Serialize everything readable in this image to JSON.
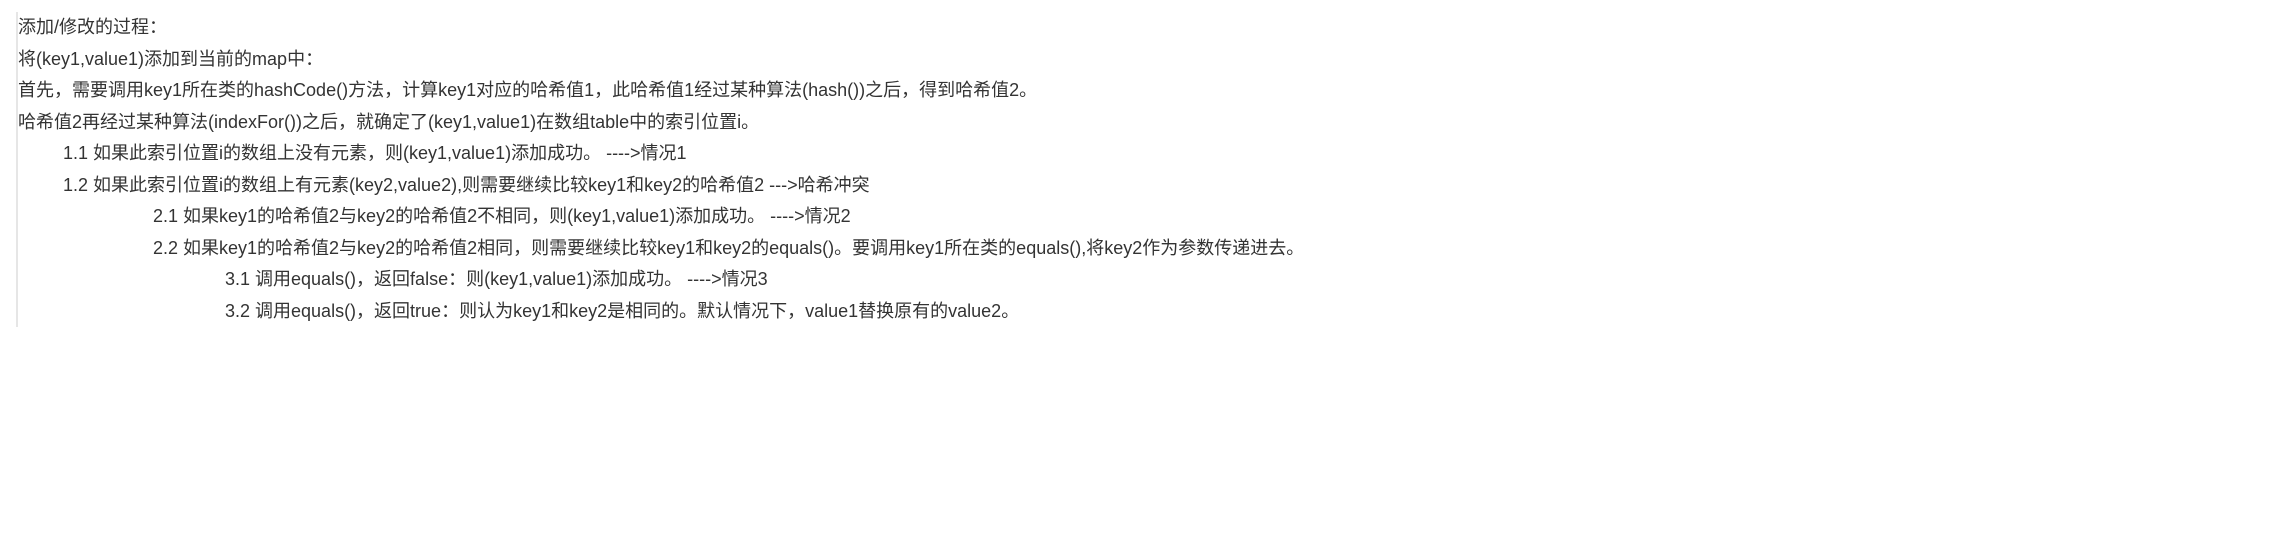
{
  "lines": {
    "l1": "添加/修改的过程：",
    "l2": "将(key1,value1)添加到当前的map中：",
    "l3": "首先，需要调用key1所在类的hashCode()方法，计算key1对应的哈希值1，此哈希值1经过某种算法(hash())之后，得到哈希值2。",
    "l4": "哈希值2再经过某种算法(indexFor())之后，就确定了(key1,value1)在数组table中的索引位置i。",
    "l5": "1.1 如果此索引位置i的数组上没有元素，则(key1,value1)添加成功。   ---->情况1",
    "l6": "1.2 如果此索引位置i的数组上有元素(key2,value2),则需要继续比较key1和key2的哈希值2   --->哈希冲突",
    "l7": "2.1 如果key1的哈希值2与key2的哈希值2不相同，则(key1,value1)添加成功。    ---->情况2",
    "l8": "2.2 如果key1的哈希值2与key2的哈希值2相同，则需要继续比较key1和key2的equals()。要调用key1所在类的equals(),将key2作为参数传递进去。",
    "l9": "3.1 调用equals()，返回false：则(key1,value1)添加成功。    ---->情况3",
    "l10": "3.2 调用equals()，返回true：则认为key1和key2是相同的。默认情况下，value1替换原有的value2。"
  }
}
